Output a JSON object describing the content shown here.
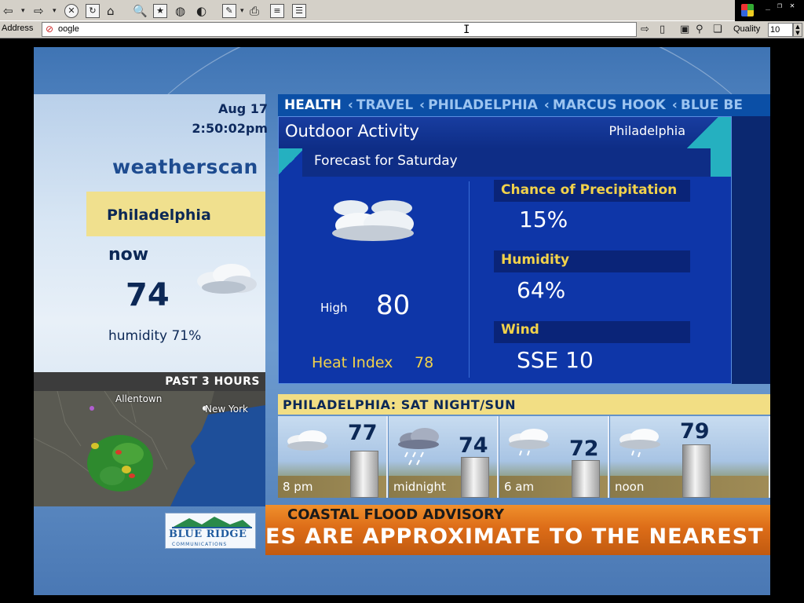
{
  "browser": {
    "address_label": "Address",
    "address_value": "oogle",
    "quality_label": "Quality",
    "quality_value": "10",
    "toolbar_icons": [
      "back-icon",
      "forward-icon",
      "stop-icon",
      "refresh-icon",
      "home-icon",
      "search-icon",
      "favorites-icon",
      "history-icon",
      "fullscreen-icon",
      "edit-icon",
      "print-icon",
      "page-icon",
      "text-icon"
    ]
  },
  "weather": {
    "date": "Aug 17",
    "time": "2:50:02pm",
    "brand": "weatherscan",
    "city": "Philadelphia",
    "now_label": "now",
    "now_temp": "74",
    "humidity_now": "humidity 71%",
    "ticker": [
      "HEALTH",
      "TRAVEL",
      "PHILADELPHIA",
      "MARCUS HOOK",
      "BLUE BE"
    ],
    "panel_title": "Outdoor Activity",
    "panel_location": "Philadelphia",
    "subtitle": "Forecast for Saturday",
    "high_label": "High",
    "high_value": "80",
    "heat_index_label": "Heat Index",
    "heat_index_value": "78",
    "precip_label": "Chance of Precipitation",
    "precip_value": "15%",
    "humidity_label": "Humidity",
    "humidity_value": "64%",
    "wind_label": "Wind",
    "wind_value": "SSE 10",
    "extended_title": "PHILADELPHIA:  SAT NIGHT/SUN",
    "extended": [
      {
        "time": "8 pm",
        "temp": "77",
        "icon": "cloudy-icon"
      },
      {
        "time": "midnight",
        "temp": "74",
        "icon": "thunder-rain-icon"
      },
      {
        "time": "6 am",
        "temp": "72",
        "icon": "cloud-rain-icon"
      },
      {
        "time": "noon",
        "temp": "79",
        "icon": "cloud-rain-icon"
      }
    ],
    "radar_title": "PAST 3 HOURS",
    "radar_cities": [
      "Allentown",
      "New York"
    ],
    "logo_text": "BLUE RIDGE",
    "logo_sub": "COMMUNICATIONS",
    "advisory_title": "COASTAL FLOOD ADVISORY",
    "advisory_crawl": "ES ARE APPROXIMATE TO THE NEAREST"
  }
}
